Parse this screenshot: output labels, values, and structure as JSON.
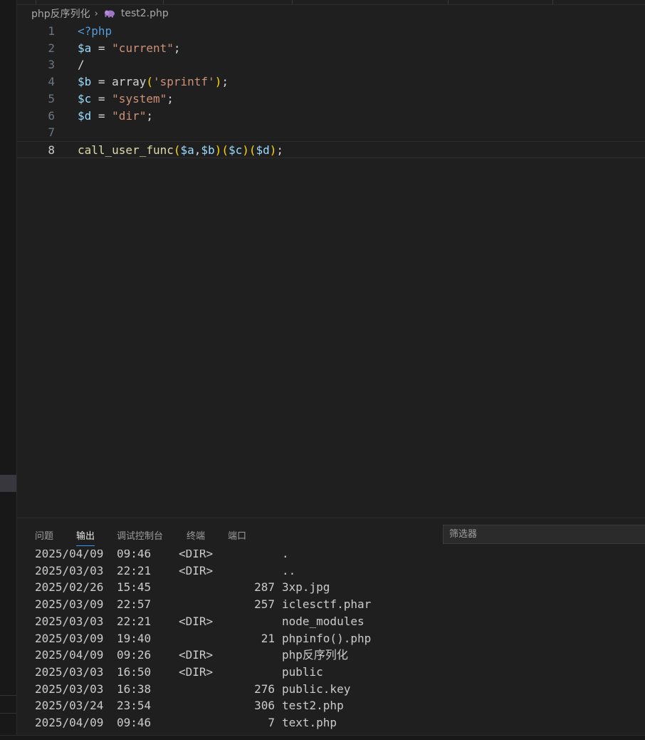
{
  "breadcrumb": {
    "folder": "php反序列化",
    "file": "test2.php"
  },
  "code_lines": [
    {
      "num": "1",
      "active": false,
      "tokens": [
        {
          "t": "<?php",
          "c": "kw"
        }
      ]
    },
    {
      "num": "2",
      "active": false,
      "tokens": [
        {
          "t": "$a",
          "c": "var"
        },
        {
          "t": " = ",
          "c": "op"
        },
        {
          "t": "\"current\"",
          "c": "str"
        },
        {
          "t": ";",
          "c": "op"
        }
      ]
    },
    {
      "num": "3",
      "active": false,
      "tokens": [
        {
          "t": "/",
          "c": "op"
        }
      ]
    },
    {
      "num": "4",
      "active": false,
      "tokens": [
        {
          "t": "$b",
          "c": "var"
        },
        {
          "t": " = ",
          "c": "op"
        },
        {
          "t": "array",
          "c": "op"
        },
        {
          "t": "(",
          "c": "p1"
        },
        {
          "t": "'sprintf'",
          "c": "str"
        },
        {
          "t": ")",
          "c": "p1"
        },
        {
          "t": ";",
          "c": "op"
        }
      ]
    },
    {
      "num": "5",
      "active": false,
      "tokens": [
        {
          "t": "$c",
          "c": "var"
        },
        {
          "t": " = ",
          "c": "op"
        },
        {
          "t": "\"system\"",
          "c": "str"
        },
        {
          "t": ";",
          "c": "op"
        }
      ]
    },
    {
      "num": "6",
      "active": false,
      "tokens": [
        {
          "t": "$d",
          "c": "var"
        },
        {
          "t": " = ",
          "c": "op"
        },
        {
          "t": "\"dir\"",
          "c": "str"
        },
        {
          "t": ";",
          "c": "op"
        }
      ]
    },
    {
      "num": "7",
      "active": false,
      "tokens": []
    },
    {
      "num": "8",
      "active": true,
      "tokens": [
        {
          "t": "call_user_func",
          "c": "fn"
        },
        {
          "t": "(",
          "c": "p1"
        },
        {
          "t": "$a",
          "c": "var"
        },
        {
          "t": ",",
          "c": "op"
        },
        {
          "t": "$b",
          "c": "var"
        },
        {
          "t": ")",
          "c": "p1"
        },
        {
          "t": "(",
          "c": "p1"
        },
        {
          "t": "$c",
          "c": "var"
        },
        {
          "t": ")",
          "c": "p1"
        },
        {
          "t": "(",
          "c": "p1"
        },
        {
          "t": "$d",
          "c": "var"
        },
        {
          "t": ")",
          "c": "p1"
        },
        {
          "t": ";",
          "c": "op"
        }
      ]
    }
  ],
  "panel": {
    "tabs": [
      {
        "label": "问题",
        "active": false
      },
      {
        "label": "输出",
        "active": true
      },
      {
        "label": "调试控制台",
        "active": false
      },
      {
        "label": "终端",
        "active": false
      },
      {
        "label": "端口",
        "active": false
      }
    ],
    "filter_placeholder": "筛选器"
  },
  "output_rows": [
    {
      "date": "2025/04/09",
      "time": "09:46",
      "dir": "<DIR>",
      "size": "",
      "name": "."
    },
    {
      "date": "2025/03/03",
      "time": "22:21",
      "dir": "<DIR>",
      "size": "",
      "name": ".."
    },
    {
      "date": "2025/02/26",
      "time": "15:45",
      "dir": "",
      "size": "287",
      "name": "3xp.jpg"
    },
    {
      "date": "2025/03/09",
      "time": "22:57",
      "dir": "",
      "size": "257",
      "name": "iclesctf.phar"
    },
    {
      "date": "2025/03/03",
      "time": "22:21",
      "dir": "<DIR>",
      "size": "",
      "name": "node_modules"
    },
    {
      "date": "2025/03/09",
      "time": "19:40",
      "dir": "",
      "size": "21",
      "name": "phpinfo().php"
    },
    {
      "date": "2025/04/09",
      "time": "09:26",
      "dir": "<DIR>",
      "size": "",
      "name": "php反序列化"
    },
    {
      "date": "2025/03/03",
      "time": "16:50",
      "dir": "<DIR>",
      "size": "",
      "name": "public"
    },
    {
      "date": "2025/03/03",
      "time": "16:38",
      "dir": "",
      "size": "276",
      "name": "public.key"
    },
    {
      "date": "2025/03/24",
      "time": "23:54",
      "dir": "",
      "size": "306",
      "name": "test2.php"
    },
    {
      "date": "2025/04/09",
      "time": "09:46",
      "dir": "",
      "size": "7",
      "name": "text.php"
    }
  ],
  "colors": {
    "accent": "#3794ff",
    "php_icon": "#a074c4",
    "background": "#1f1f1f"
  }
}
